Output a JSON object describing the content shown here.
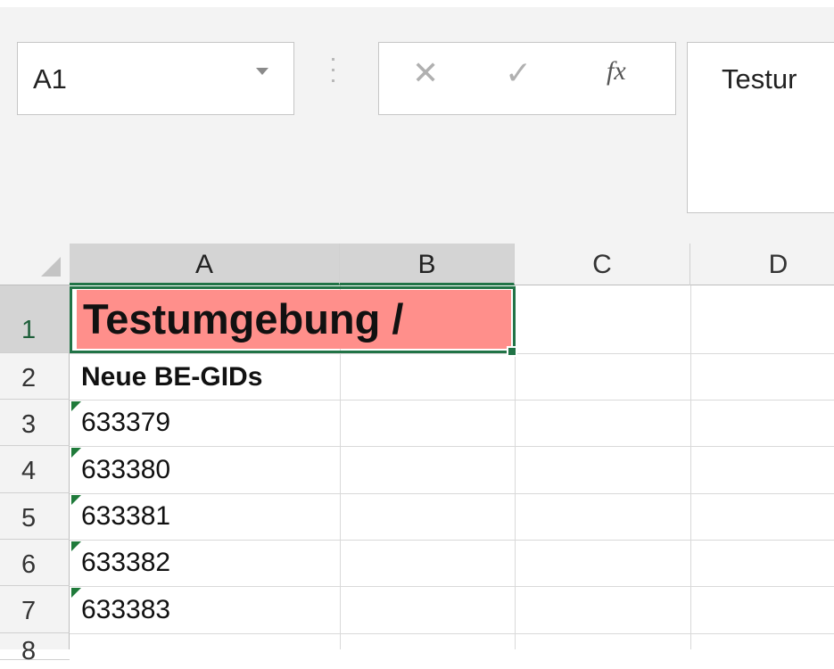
{
  "formula_bar": {
    "name_box": "A1",
    "cancel_icon": "✕",
    "enter_icon": "✓",
    "fx_icon": "fx",
    "content": "Testur"
  },
  "columns": [
    "A",
    "B",
    "C",
    "D"
  ],
  "rows": [
    "1",
    "2",
    "3",
    "4",
    "5",
    "6",
    "7",
    "8"
  ],
  "cells": {
    "A1": "Testumgebung /",
    "A2": "Neue BE-GIDs",
    "A3": "633379",
    "A4": "633380",
    "A5": "633381",
    "A6": "633382",
    "A7": "633383"
  },
  "colors": {
    "selection_accent": "#217346",
    "a1_fill": "#ff8f8b",
    "number_as_text_indicator": "#1f7a3a"
  }
}
